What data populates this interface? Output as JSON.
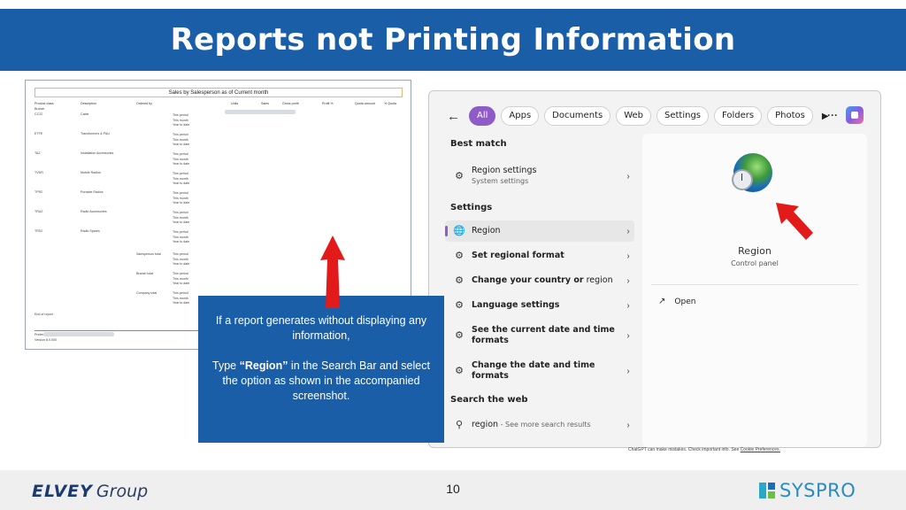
{
  "slide": {
    "title": "Reports not Printing Information",
    "page_number": "10"
  },
  "report": {
    "title": "Sales by Salesperson as of Current month",
    "headers": [
      "Product class",
      "Description",
      "Ordered by",
      "Units",
      "Sales",
      "Gross profit",
      "Profit %",
      "Quota amount",
      "% Quota"
    ],
    "branch_label": "Branch",
    "rows": [
      {
        "code": "CC22",
        "desc": "Cable"
      },
      {
        "code": "ETFE",
        "desc": "Transformers & P&U"
      },
      {
        "code": "TAZ",
        "desc": "Installation Accessories"
      },
      {
        "code": "TVDR",
        "desc": "Mobile Radios"
      },
      {
        "code": "TPR2",
        "desc": "Portable Radios"
      },
      {
        "code": "TRAZ",
        "desc": "Radio Accessories"
      },
      {
        "code": "TRS2",
        "desc": "Radio Spares"
      }
    ],
    "period_lines": [
      "This period",
      "This month",
      "Year to date"
    ],
    "totals": [
      "Salesperson total",
      "Branch total",
      "Company total"
    ],
    "end_of_report": "End of report",
    "printed_label": "Printed",
    "version_label": "Version 8.0.000"
  },
  "search": {
    "filters": [
      "All",
      "Apps",
      "Documents",
      "Web",
      "Settings",
      "Folders",
      "Photos"
    ],
    "more": "···",
    "best_match_label": "Best match",
    "best_match": {
      "title": "Region settings",
      "subtitle": "System settings"
    },
    "settings_label": "Settings",
    "settings_items": [
      {
        "pre": "",
        "bold": "Region",
        "post": ""
      },
      {
        "pre": "",
        "bold": "Set regional format",
        "post": ""
      },
      {
        "pre": "",
        "bold": "Change your country or",
        "post": " region"
      },
      {
        "pre": "",
        "bold": "Language settings",
        "post": ""
      },
      {
        "pre": "",
        "bold": "See the current date and time formats",
        "post": ""
      },
      {
        "pre": "",
        "bold": "Change the date and time formats",
        "post": ""
      }
    ],
    "web_label": "Search the web",
    "web_item": {
      "query": "region",
      "hint": " - See more search results"
    },
    "detail": {
      "title": "Region",
      "subtitle": "Control panel",
      "open": "Open"
    },
    "disclaimer": "ChatGPT can make mistakes. Check important info. See",
    "disclaimer_link": "Cookie Preferences."
  },
  "callout": {
    "line1": "If a report generates without displaying any information,",
    "line2_pre": "Type ",
    "line2_bold": "“Region”",
    "line2_post": " in the Search Bar and select the option as shown in the accompanied screenshot."
  },
  "footer": {
    "elvey_brand": "ELVEY",
    "elvey_group": "Group",
    "syspro": "SYSPRO"
  },
  "colors": {
    "brand_blue": "#1a5ea8",
    "accent_purple": "#8e5bc8",
    "arrow_red": "#e31a1a"
  }
}
